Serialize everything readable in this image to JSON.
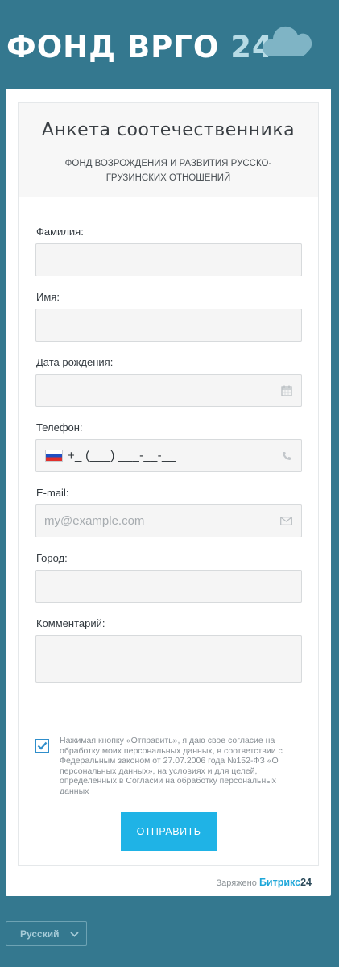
{
  "header": {
    "logo_main": "ФОНД ВРГО",
    "logo_num": "24"
  },
  "form": {
    "title": "Анкета соотечественника",
    "subtitle": "ФОНД ВОЗРОЖДЕНИЯ И РАЗВИТИЯ РУССКО-ГРУЗИНСКИХ ОТНОШЕНИЙ",
    "fields": {
      "lastname": {
        "label": "Фамилия:",
        "value": ""
      },
      "firstname": {
        "label": "Имя:",
        "value": ""
      },
      "birthdate": {
        "label": "Дата рождения:",
        "value": ""
      },
      "phone": {
        "label": "Телефон:",
        "mask": "+_ (___) ___-__-__"
      },
      "email": {
        "label": "E-mail:",
        "placeholder": "my@example.com"
      },
      "city": {
        "label": "Город:",
        "value": ""
      },
      "comment": {
        "label": "Комментарий:",
        "value": ""
      }
    },
    "consent": {
      "checked": true,
      "text": "Нажимая кнопку «Отправить», я даю свое согласие на обработку моих персональных данных, в соответствии с Федеральным законом от 27.07.2006 года №152-ФЗ «О персональных данных», на условиях и для целей, определенных в Согласии на обработку персональных данных"
    },
    "submit_label": "ОТПРАВИТЬ"
  },
  "footer": {
    "powered_prefix": "Заряжено",
    "brand_part1": "Битрикс",
    "brand_part2": "24",
    "language": "Русский"
  },
  "colors": {
    "background": "#34788f",
    "accent": "#1fb3e6",
    "checkbox": "#2f8ecb"
  },
  "icons": [
    "cloud-icon",
    "calendar-icon",
    "phone-icon",
    "envelope-icon",
    "russia-flag-icon",
    "checkmark-icon",
    "chevron-down-icon"
  ]
}
